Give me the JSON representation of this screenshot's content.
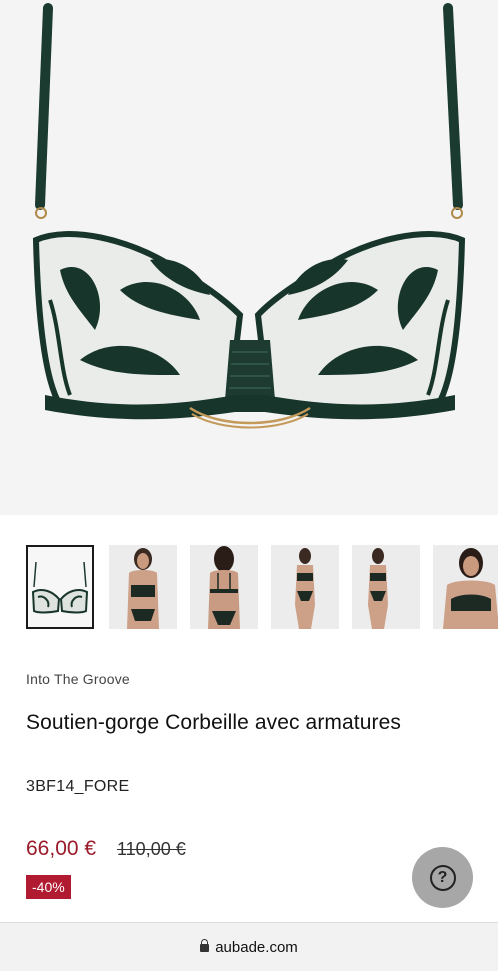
{
  "product": {
    "collection": "Into The Groove",
    "title": "Soutien-gorge Corbeille avec armatures",
    "reference": "3BF14_FORE",
    "price_current": "66,00 €",
    "price_original": "110,00 €",
    "discount_badge": "-40%"
  },
  "gallery": {
    "main_image": "green-embroidered-balconette-bra",
    "thumbnails": [
      {
        "subject": "bra-product-shot",
        "selected": true
      },
      {
        "subject": "model-front-bra-set",
        "selected": false
      },
      {
        "subject": "model-back-view",
        "selected": false
      },
      {
        "subject": "model-full-body-front",
        "selected": false
      },
      {
        "subject": "model-full-body-front-2",
        "selected": false
      },
      {
        "subject": "model-close-up-front",
        "selected": false
      }
    ]
  },
  "help": {
    "icon": "question-icon"
  },
  "browser": {
    "url": "aubade.com",
    "icon": "lock-icon"
  },
  "colors": {
    "price_red": "#9b1b2a",
    "badge_red": "#b11b32",
    "bra_green": "#17352b"
  }
}
